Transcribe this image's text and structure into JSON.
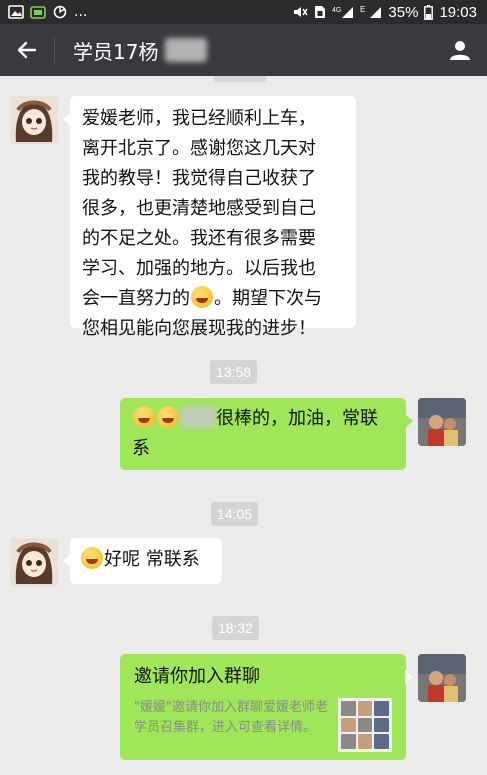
{
  "status_bar": {
    "battery": "35%",
    "time": "19:03",
    "signal_labels": [
      "4G",
      "E"
    ],
    "overflow": "..."
  },
  "header": {
    "title": "学员17杨"
  },
  "messages": [
    {
      "side": "left",
      "text_lines": [
        "爱媛老师，我已经顺利上车，",
        "离开北京了。感谢您这几天对",
        "我的教导！我觉得自己收获了",
        "很多，也更清楚地感受到自己",
        "的不足之处。我还有很多需要",
        "学习、加强的地方。以后我也",
        "会一直努力的",
        "。期望下次与",
        "您相见能向您展现我的进步！"
      ]
    },
    {
      "type": "time",
      "text": "13:58"
    },
    {
      "side": "right",
      "text_lines": [
        "很棒的，加油，常联",
        "系"
      ]
    },
    {
      "type": "time",
      "text": "14:05"
    },
    {
      "side": "left",
      "text": "好呢  常联系"
    },
    {
      "type": "time",
      "text": "18:32"
    },
    {
      "side": "right",
      "type": "group_invite_card",
      "title": "邀请你加入群聊",
      "description": "\"媛媛\"邀请你加入群聊爱媛老师老学员召集群，进入可查看详情。"
    }
  ],
  "colors": {
    "titlebar": "#393a3f",
    "statusbar": "#2b2b2b",
    "chat_bg": "#ebebeb",
    "right_bubble": "#9fe658",
    "left_bubble": "#ffffff",
    "time_pill": "#d4d4d4"
  },
  "icons": {
    "back": "back-arrow-icon",
    "contact": "person-icon"
  }
}
